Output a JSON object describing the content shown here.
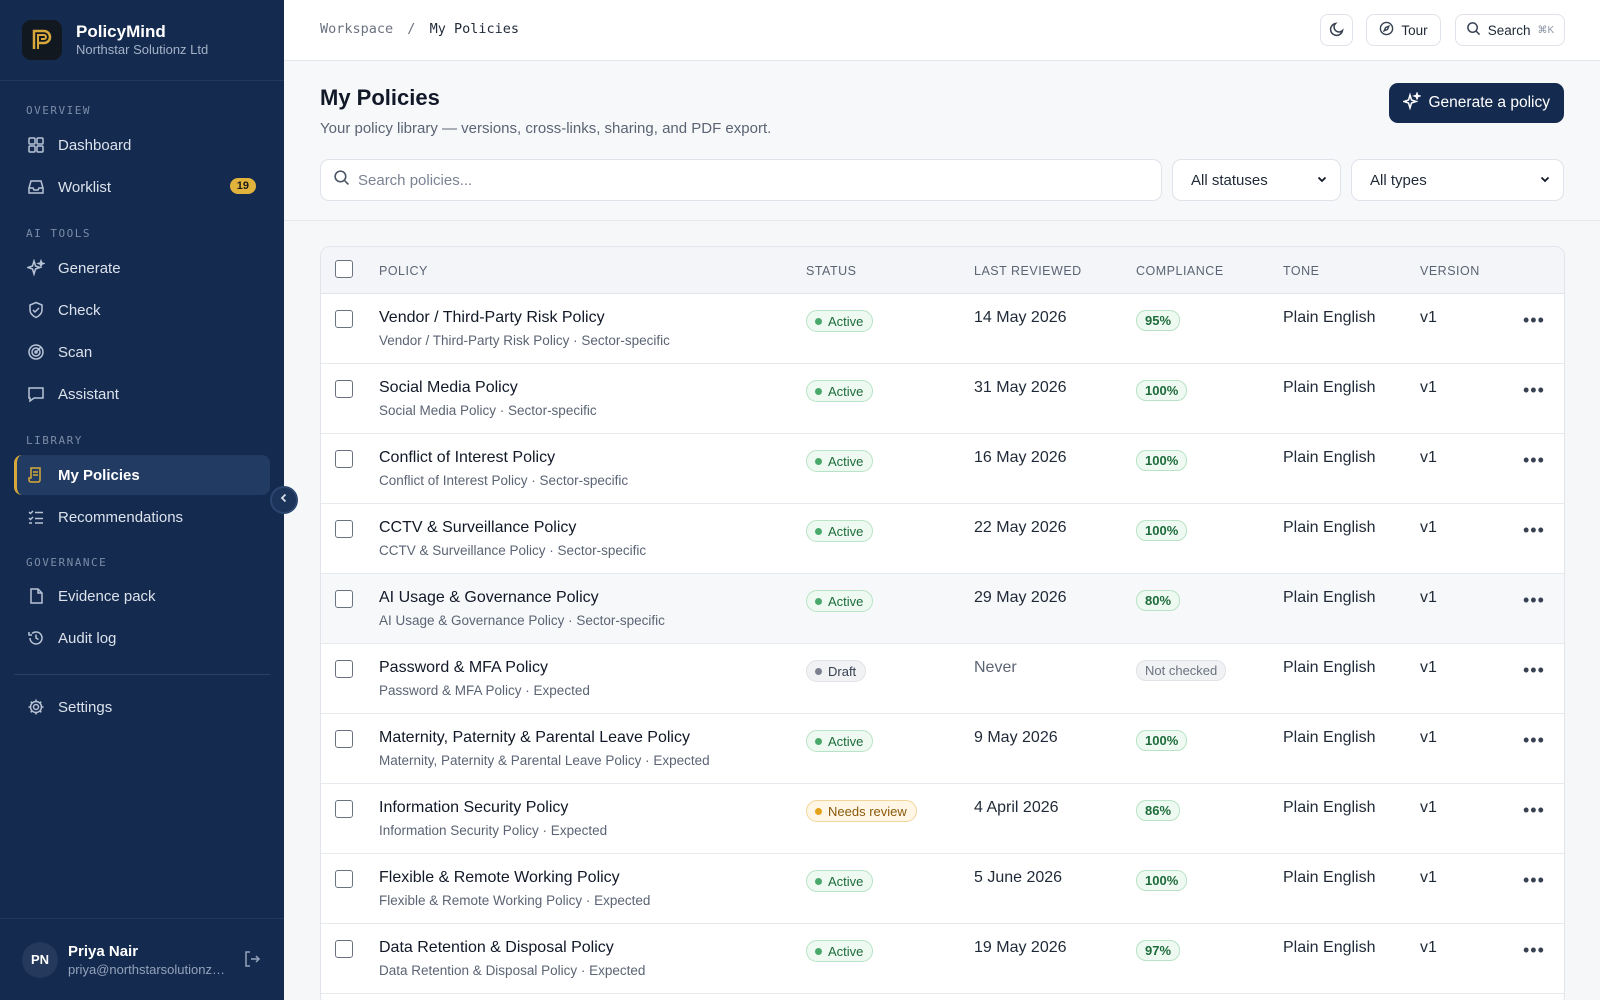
{
  "app": {
    "name": "PolicyMind",
    "org": "Northstar Solutionz Ltd"
  },
  "sidebar": {
    "sections": [
      {
        "label": "OVERVIEW"
      },
      {
        "label": "AI TOOLS"
      },
      {
        "label": "LIBRARY"
      },
      {
        "label": "GOVERNANCE"
      }
    ],
    "items": [
      {
        "label": "Dashboard",
        "icon": "dashboard-icon"
      },
      {
        "label": "Worklist",
        "icon": "inbox-icon",
        "badge": "19"
      },
      {
        "label": "Generate",
        "icon": "sparkles-icon"
      },
      {
        "label": "Check",
        "icon": "shield-check-icon"
      },
      {
        "label": "Scan",
        "icon": "radar-icon"
      },
      {
        "label": "Assistant",
        "icon": "chat-icon"
      },
      {
        "label": "My Policies",
        "icon": "policy-scroll-icon",
        "active": true
      },
      {
        "label": "Recommendations",
        "icon": "checklist-icon"
      },
      {
        "label": "Evidence pack",
        "icon": "file-icon"
      },
      {
        "label": "Audit log",
        "icon": "history-icon"
      },
      {
        "label": "Settings",
        "icon": "gear-icon"
      }
    ],
    "user": {
      "initials": "PN",
      "name": "Priya Nair",
      "email": "priya@northstarsolutionz.co.uk"
    }
  },
  "topbar": {
    "breadcrumb": {
      "parent": "Workspace",
      "separator": "/",
      "current": "My Policies"
    },
    "tour_label": "Tour",
    "search_label": "Search",
    "search_shortcut": "⌘K"
  },
  "header": {
    "title": "My Policies",
    "subtitle": "Your policy library — versions, cross-links, sharing, and PDF export.",
    "generate_label": "Generate a policy",
    "search_placeholder": "Search policies...",
    "status_filter": "All statuses",
    "type_filter": "All types"
  },
  "table": {
    "columns": {
      "policy": "POLICY",
      "status": "STATUS",
      "last_reviewed": "LAST REVIEWED",
      "compliance": "COMPLIANCE",
      "tone": "TONE",
      "version": "VERSION"
    },
    "rows": [
      {
        "name": "Vendor / Third-Party Risk Policy",
        "sub": "Vendor / Third-Party Risk Policy · Sector-specific",
        "status": "Active",
        "reviewed": "14 May 2026",
        "compliance": "95%",
        "tone": "Plain English",
        "version": "v1"
      },
      {
        "name": "Social Media Policy",
        "sub": "Social Media Policy · Sector-specific",
        "status": "Active",
        "reviewed": "31 May 2026",
        "compliance": "100%",
        "tone": "Plain English",
        "version": "v1"
      },
      {
        "name": "Conflict of Interest Policy",
        "sub": "Conflict of Interest Policy · Sector-specific",
        "status": "Active",
        "reviewed": "16 May 2026",
        "compliance": "100%",
        "tone": "Plain English",
        "version": "v1"
      },
      {
        "name": "CCTV & Surveillance Policy",
        "sub": "CCTV & Surveillance Policy · Sector-specific",
        "status": "Active",
        "reviewed": "22 May 2026",
        "compliance": "100%",
        "tone": "Plain English",
        "version": "v1"
      },
      {
        "name": "AI Usage & Governance Policy",
        "sub": "AI Usage & Governance Policy · Sector-specific",
        "status": "Active",
        "reviewed": "29 May 2026",
        "compliance": "80%",
        "tone": "Plain English",
        "version": "v1"
      },
      {
        "name": "Password & MFA Policy",
        "sub": "Password & MFA Policy · Expected",
        "status": "Draft",
        "reviewed": "Never",
        "compliance": "Not checked",
        "tone": "Plain English",
        "version": "v1"
      },
      {
        "name": "Maternity, Paternity & Parental Leave Policy",
        "sub": "Maternity, Paternity & Parental Leave Policy · Expected",
        "status": "Active",
        "reviewed": "9 May 2026",
        "compliance": "100%",
        "tone": "Plain English",
        "version": "v1"
      },
      {
        "name": "Information Security Policy",
        "sub": "Information Security Policy · Expected",
        "status": "Needs review",
        "reviewed": "4 April 2026",
        "compliance": "86%",
        "tone": "Plain English",
        "version": "v1"
      },
      {
        "name": "Flexible & Remote Working Policy",
        "sub": "Flexible & Remote Working Policy · Expected",
        "status": "Active",
        "reviewed": "5 June 2026",
        "compliance": "100%",
        "tone": "Plain English",
        "version": "v1"
      },
      {
        "name": "Data Retention & Disposal Policy",
        "sub": "Data Retention & Disposal Policy · Expected",
        "status": "Active",
        "reviewed": "19 May 2026",
        "compliance": "97%",
        "tone": "Plain English",
        "version": "v1"
      }
    ]
  },
  "colors": {
    "sidebar_bg": "#142a4e",
    "accent": "#142a4e",
    "badge": "#e2b33c",
    "active_status": "#1d6b3a",
    "review_status": "#8a5a0b"
  }
}
